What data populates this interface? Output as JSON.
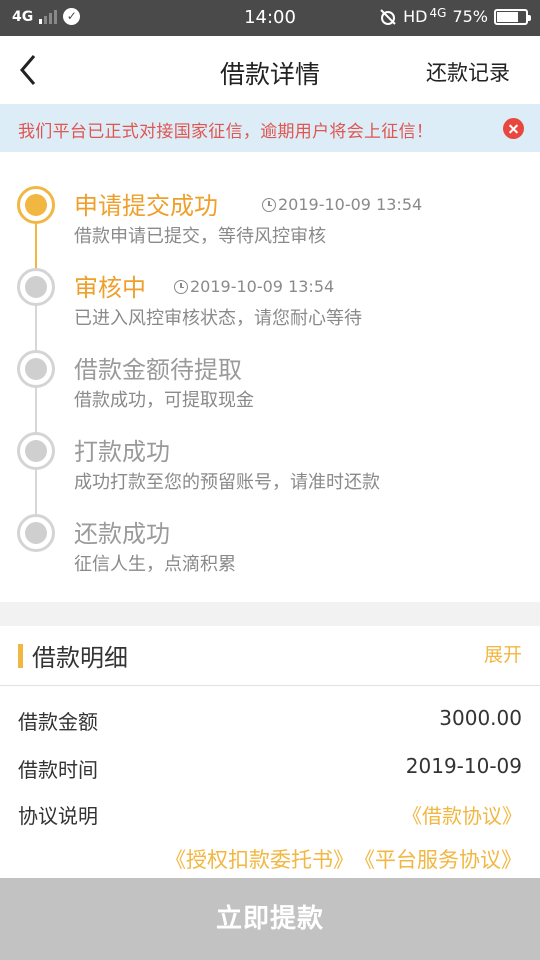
{
  "status_bar": {
    "network": "4G",
    "time": "14:00",
    "right_text": "HD",
    "right_network": "4G",
    "battery": "75%",
    "battery_level": 0.75
  },
  "nav": {
    "title": "借款详情",
    "right_label": "还款记录"
  },
  "notice": {
    "text": "我们平台已正式对接国家征信，逾期用户将会上征信！"
  },
  "timeline": {
    "steps": [
      {
        "title": "申请提交成功",
        "time": "2019-10-09 13:54",
        "desc": "借款申请已提交，等待风控审核",
        "state": "done"
      },
      {
        "title": "审核中",
        "time": "2019-10-09 13:54",
        "desc": "已进入风控审核状态，请您耐心等待",
        "state": "current"
      },
      {
        "title": "借款金额待提取",
        "time": "",
        "desc": "借款成功，可提取现金",
        "state": "pending"
      },
      {
        "title": "打款成功",
        "time": "",
        "desc": "成功打款至您的预留账号，请准时还款",
        "state": "pending"
      },
      {
        "title": "还款成功",
        "time": "",
        "desc": "征信人生，点滴积累",
        "state": "pending"
      }
    ]
  },
  "detail": {
    "title": "借款明细",
    "expand_label": "展开",
    "rows": [
      {
        "label": "借款金额",
        "value": "3000.00"
      },
      {
        "label": "借款时间",
        "value": "2019-10-09"
      },
      {
        "label": "协议说明",
        "value": "《借款协议》"
      }
    ],
    "agreements": [
      "《授权扣款委托书》",
      "《平台服务协议》"
    ]
  },
  "cta": {
    "label": "立即提款"
  },
  "colors": {
    "accent": "#f2b742",
    "accent_text": "#ef9f2c",
    "notice_bg": "#dcedf8",
    "notice_text": "#e05550",
    "status_bar": "#4a4a4a",
    "cta_bg": "#c2c2c2"
  }
}
